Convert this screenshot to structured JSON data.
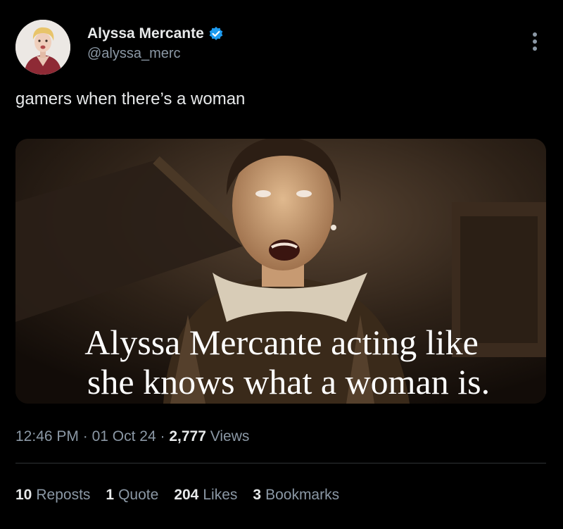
{
  "author": {
    "display_name": "Alyssa Mercante",
    "handle": "@alyssa_merc",
    "verified": true,
    "avatar_icon": "profile-photo"
  },
  "tweet": {
    "text": "gamers when there’s a woman"
  },
  "media": {
    "caption_line1": "Alyssa Mercante acting like",
    "caption_line2": "she knows what a woman is."
  },
  "meta": {
    "time": "12:46 PM",
    "separator": "·",
    "date": "01 Oct 24",
    "views_count": "2,777",
    "views_label": "Views"
  },
  "stats": [
    {
      "count": "10",
      "label": "Reposts"
    },
    {
      "count": "1",
      "label": "Quote"
    },
    {
      "count": "204",
      "label": "Likes"
    },
    {
      "count": "3",
      "label": "Bookmarks"
    }
  ],
  "colors": {
    "background": "#000000",
    "primary_text": "#e7e9ea",
    "secondary_text": "#8b98a5",
    "verified_blue": "#1d9bf0",
    "divider": "#2f3336"
  }
}
